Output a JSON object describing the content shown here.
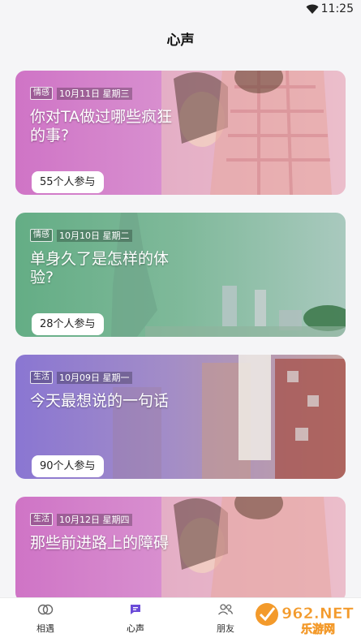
{
  "status_bar": {
    "time": "11:25",
    "icon": "wifi-icon"
  },
  "header": {
    "title": "心声"
  },
  "cards": [
    {
      "tag": "情感",
      "date": "10月11日 星期三",
      "headline": "你对TA做过哪些疯狂的事?",
      "count": "55个人参与",
      "tint": "#c877c0"
    },
    {
      "tag": "情感",
      "date": "10月10日 星期二",
      "headline": "单身久了是怎样的体验?",
      "count": "28个人参与",
      "tint": "#6ab08a"
    },
    {
      "tag": "生活",
      "date": "10月09日 星期一",
      "headline": "今天最想说的一句话",
      "count": "90个人参与",
      "tint": "#8f7fd3"
    },
    {
      "tag": "生活",
      "date": "10月12日 星期四",
      "headline": "那些前进路上的障碍",
      "count": "",
      "tint": "#c877c0"
    }
  ],
  "tabs": [
    {
      "label": "相遇",
      "icon": "meet-icon",
      "active": false
    },
    {
      "label": "心声",
      "icon": "chat-icon",
      "active": true
    },
    {
      "label": "朋友",
      "icon": "friends-icon",
      "active": false
    }
  ],
  "watermark": {
    "text": "962.NET",
    "subtext": "乐游网"
  },
  "colors": {
    "accent": "#6b4bd8",
    "background": "#f5f5f7"
  }
}
